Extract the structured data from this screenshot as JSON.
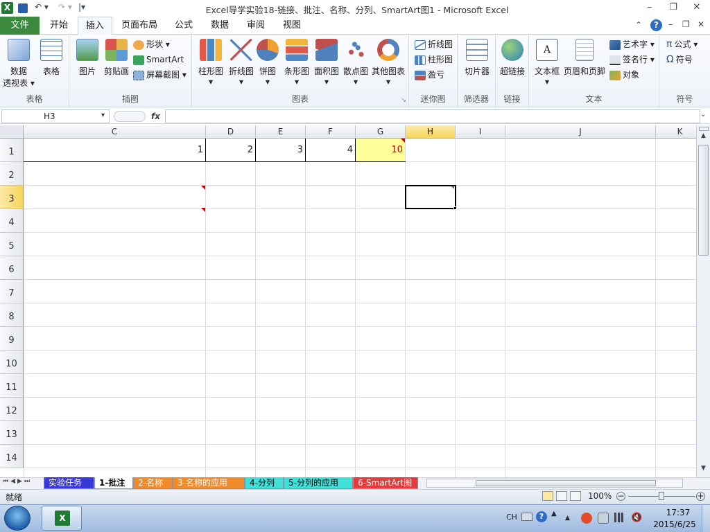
{
  "window": {
    "title": "Excel导学实验18-链接、批注、名称、分列、SmartArt图1  -  Microsoft Excel",
    "minimize": "–",
    "restore": "❐",
    "close": "✕",
    "doc_minimize": "–",
    "doc_restore": "❐",
    "doc_close": "✕"
  },
  "qat": {
    "excel": "X",
    "save": "💾",
    "undo": "↶ ▾",
    "redo": "↷ ▾",
    "customize": "|▾"
  },
  "tabs": [
    "文件",
    "开始",
    "插入",
    "页面布局",
    "公式",
    "数据",
    "审阅",
    "视图"
  ],
  "ribbon": {
    "groups": {
      "tables": "表格",
      "illustrations": "插图",
      "charts": "图表",
      "sparklines": "迷你图",
      "filter": "筛选器",
      "links": "链接",
      "text": "文本",
      "symbols": "符号"
    },
    "pivot_label_1": "数据",
    "pivot_label_2": "透视表 ▾",
    "table": "表格",
    "picture": "图片",
    "clipart": "剪贴画",
    "shapes": "形状 ▾",
    "smartart": "SmartArt",
    "screenshot": "屏幕截图 ▾",
    "column": "柱形图",
    "line": "折线图",
    "pie": "饼图",
    "bar": "条形图",
    "area": "面积图",
    "scatter": "散点图",
    "other": "其他图表",
    "spark_line": "折线图",
    "spark_column": "柱形图",
    "spark_winloss": "盈亏",
    "slicer": "切片器",
    "hyperlink": "超链接",
    "textbox": "文本框",
    "header_footer": "页眉和页脚",
    "wordart": "艺术字 ▾",
    "signature": "签名行 ▾",
    "object": "对象",
    "equation": "公式 ▾",
    "symbol": "符号",
    "dropdown": "▾"
  },
  "formula_bar": {
    "name_box": "H3",
    "fx": "fx",
    "value": ""
  },
  "columns": [
    "C",
    "D",
    "E",
    "F",
    "G",
    "H",
    "I",
    "J",
    "K"
  ],
  "rows": [
    "1",
    "2",
    "3",
    "4",
    "5",
    "6",
    "7",
    "8",
    "9",
    "10",
    "11",
    "12",
    "13",
    "14"
  ],
  "cells": {
    "C1": "1",
    "D1": "2",
    "E1": "3",
    "F1": "4",
    "G1": "10"
  },
  "sheets": [
    "实验任务",
    "1-批注",
    "2-名称",
    "3-名称的应用",
    "4-分列",
    "5-分列的应用",
    "6-SmartArt图"
  ],
  "status": {
    "ready": "就绪",
    "zoom": "100%"
  },
  "taskbar": {
    "lang": "CH",
    "time": "17:37",
    "date": "2015/6/25"
  },
  "colors": {
    "accent": "#3c8a3d",
    "selected_header": "#f7d45a",
    "highlight_cell": "#ffff99",
    "red_value": "#c00000"
  }
}
